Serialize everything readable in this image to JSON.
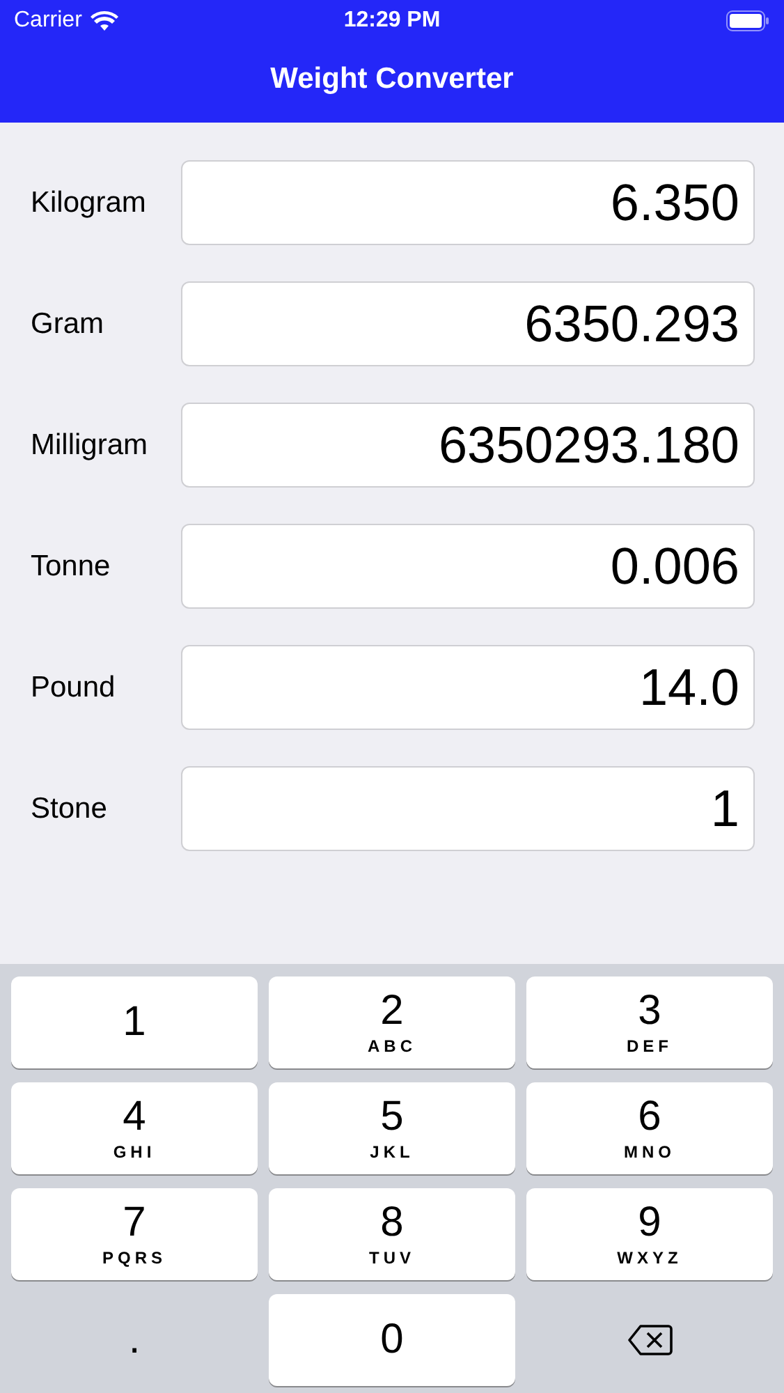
{
  "status_bar": {
    "carrier": "Carrier",
    "time": "12:29 PM"
  },
  "nav_bar": {
    "title": "Weight Converter"
  },
  "fields": [
    {
      "label": "Kilogram",
      "value": "6.350"
    },
    {
      "label": "Gram",
      "value": "6350.293"
    },
    {
      "label": "Milligram",
      "value": "6350293.180"
    },
    {
      "label": "Tonne",
      "value": "0.006"
    },
    {
      "label": "Pound",
      "value": "14.0"
    },
    {
      "label": "Stone",
      "value": "1"
    }
  ],
  "keypad": [
    {
      "kind": "digit",
      "digit": "1"
    },
    {
      "kind": "digit",
      "digit": "2",
      "letters": "ABC"
    },
    {
      "kind": "digit",
      "digit": "3",
      "letters": "DEF"
    },
    {
      "kind": "digit",
      "digit": "4",
      "letters": "GHI"
    },
    {
      "kind": "digit",
      "digit": "5",
      "letters": "JKL"
    },
    {
      "kind": "digit",
      "digit": "6",
      "letters": "MNO"
    },
    {
      "kind": "digit",
      "digit": "7",
      "letters": "PQRS"
    },
    {
      "kind": "digit",
      "digit": "8",
      "letters": "TUV"
    },
    {
      "kind": "digit",
      "digit": "9",
      "letters": "WXYZ"
    },
    {
      "kind": "plain",
      "digit": "."
    },
    {
      "kind": "digit",
      "digit": "0"
    },
    {
      "kind": "delete"
    }
  ]
}
